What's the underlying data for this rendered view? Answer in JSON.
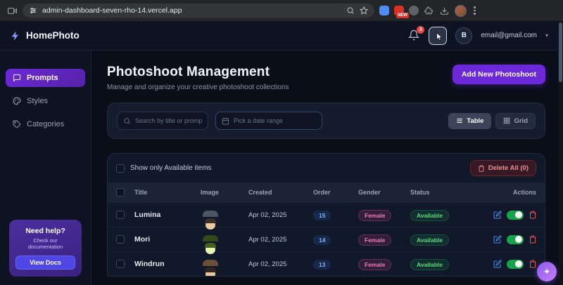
{
  "browser": {
    "url": "admin-dashboard-seven-rho-14.vercel.app",
    "new_badge": "NEW"
  },
  "header": {
    "brand": "HomePhoto",
    "notification_count": "3",
    "avatar_initial": "B",
    "email": "email@gmail.com"
  },
  "sidebar": {
    "items": [
      {
        "label": "Prompts"
      },
      {
        "label": "Styles"
      },
      {
        "label": "Categories"
      }
    ],
    "help": {
      "title": "Need help?",
      "subtitle": "Check our documentation",
      "button_label": "View Docs"
    }
  },
  "page": {
    "title": "Photoshoot Management",
    "subtitle": "Manage and organize your creative photoshoot collections",
    "add_button_label": "Add New Photoshoot"
  },
  "filters": {
    "search_placeholder": "Search by title or prompt",
    "date_placeholder": "Pick a date range",
    "table_view_label": "Table",
    "grid_view_label": "Grid"
  },
  "list_controls": {
    "show_only_label": "Show only Available items",
    "delete_all_label": "Delete All (0)"
  },
  "table": {
    "headers": [
      "Title",
      "Image",
      "Created",
      "Order",
      "Gender",
      "Status",
      "Actions"
    ],
    "rows": [
      {
        "title": "Lumina",
        "created": "Apr 02, 2025",
        "order": "15",
        "gender": "Female",
        "status": "Available"
      },
      {
        "title": "Mori",
        "created": "Apr 02, 2025",
        "order": "14",
        "gender": "Female",
        "status": "Available"
      },
      {
        "title": "Windrun",
        "created": "Apr 02, 2025",
        "order": "13",
        "gender": "Female",
        "status": "Available"
      }
    ]
  },
  "colors": {
    "accent": "#6d28d9",
    "status_available": "#57d97a",
    "gender_female": "#f07ab4",
    "order_badge": "#7ab3fa",
    "danger": "#ef4444"
  },
  "icons": {
    "chat_fab": "✦",
    "chevron_down": "▾"
  }
}
